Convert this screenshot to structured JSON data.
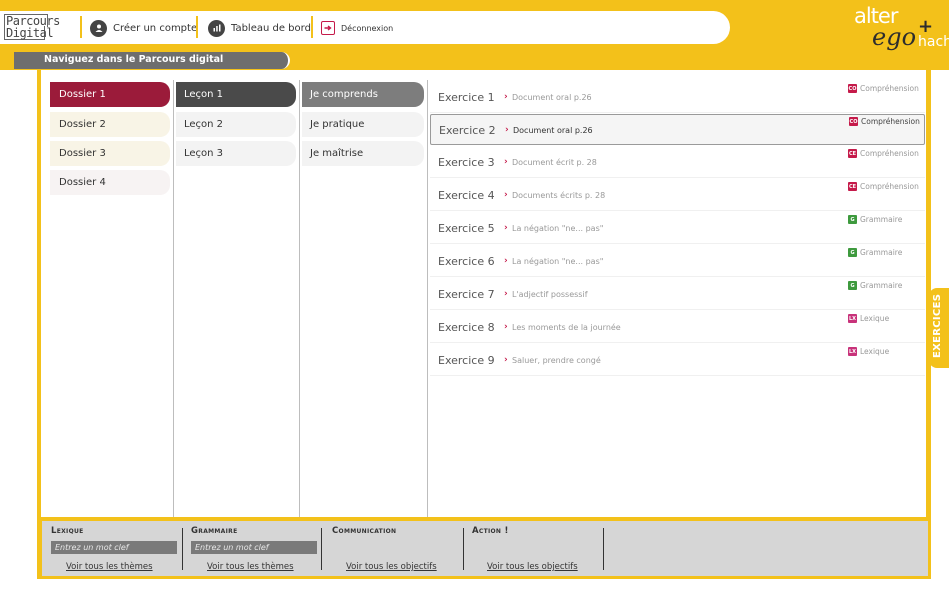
{
  "header": {
    "logo_line1": "Parcours",
    "logo_line2": "Digital",
    "nav": [
      {
        "label": "Créer un compte",
        "icon": "user-icon"
      },
      {
        "label": "Tableau de bord",
        "icon": "dashboard-icon"
      },
      {
        "label": "Déconnexion",
        "icon": "logout-icon"
      }
    ],
    "brand": {
      "alter": "alter",
      "ego": "ego",
      "plus": "+",
      "publisher": "hachette"
    }
  },
  "title_bar": "Naviguez dans le Parcours digital",
  "dossiers": [
    {
      "label": "Dossier 1",
      "active": true
    },
    {
      "label": "Dossier 2",
      "active": false
    },
    {
      "label": "Dossier 3",
      "active": false
    },
    {
      "label": "Dossier 4",
      "active": false
    }
  ],
  "lecons": [
    {
      "label": "Leçon 1",
      "active": true
    },
    {
      "label": "Leçon 2",
      "active": false
    },
    {
      "label": "Leçon 3",
      "active": false
    }
  ],
  "niveaux": [
    {
      "label": "Je comprends",
      "active": true
    },
    {
      "label": "Je pratique",
      "active": false
    },
    {
      "label": "Je maîtrise",
      "active": false
    }
  ],
  "exercises": [
    {
      "name": "Exercice 1",
      "title": "Document oral p.26",
      "category": "Compréhension",
      "cat_code": "CO"
    },
    {
      "name": "Exercice 2",
      "title": "Document oral p.26",
      "category": "Compréhension",
      "cat_code": "CO",
      "active": true
    },
    {
      "name": "Exercice 3",
      "title": "Document écrit p. 28",
      "category": "Compréhension",
      "cat_code": "CE"
    },
    {
      "name": "Exercice 4",
      "title": "Documents écrits p. 28",
      "category": "Compréhension",
      "cat_code": "CE"
    },
    {
      "name": "Exercice 5",
      "title": "La négation \"ne... pas\"",
      "category": "Grammaire",
      "cat_code": "G"
    },
    {
      "name": "Exercice 6",
      "title": "La négation \"ne... pas\"",
      "category": "Grammaire",
      "cat_code": "G"
    },
    {
      "name": "Exercice 7",
      "title": "L'adjectif possessif",
      "category": "Grammaire",
      "cat_code": "G"
    },
    {
      "name": "Exercice 8",
      "title": "Les moments de la journée",
      "category": "Lexique",
      "cat_code": "LX"
    },
    {
      "name": "Exercice 9",
      "title": "Saluer, prendre congé",
      "category": "Lexique",
      "cat_code": "LX"
    }
  ],
  "side_tab": "EXERCICES",
  "bottom": {
    "lexique": {
      "title": "Lexique",
      "placeholder": "Entrez un mot clef",
      "link": "Voir tous les thèmes"
    },
    "grammaire": {
      "title": "Grammaire",
      "placeholder": "Entrez un mot clef",
      "link": "Voir tous les thèmes"
    },
    "communication": {
      "title": "Communication",
      "link": "Voir tous les objectifs"
    },
    "action": {
      "title": "Action !",
      "link": "Voir tous les objectifs"
    }
  },
  "colors": {
    "accent_yellow": "#f3c11a",
    "dossier_active": "#9b1b3a",
    "lecon_active": "#4a4a4a",
    "niveau_active": "#7d7d7d",
    "comprehension": "#c51a4a",
    "grammaire": "#3e9a3e",
    "lexique": "#c8327a"
  }
}
